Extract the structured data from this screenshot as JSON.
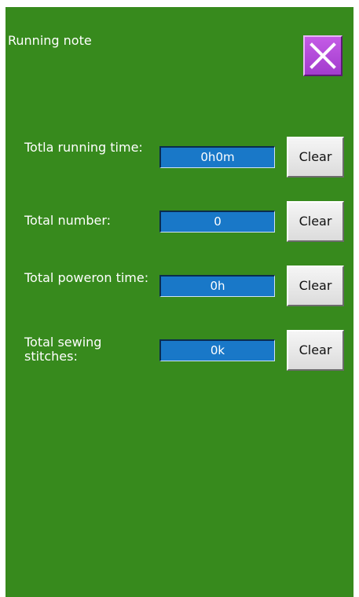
{
  "screen": {
    "title": "Running note",
    "background_color": "#378a1d",
    "close_icon": "close-x-icon"
  },
  "rows": [
    {
      "label": "Totla running time:",
      "value": "0h0m",
      "clear_label": "Clear"
    },
    {
      "label": "Total number:",
      "value": "0",
      "clear_label": "Clear"
    },
    {
      "label": "Total poweron time:",
      "value": "0h",
      "clear_label": "Clear"
    },
    {
      "label": "Total sewing stitches:",
      "value": "0k",
      "clear_label": "Clear"
    }
  ]
}
